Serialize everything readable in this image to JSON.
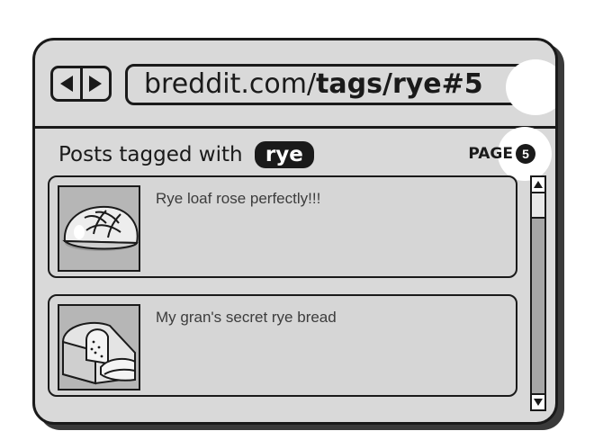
{
  "browser": {
    "back_button": "back",
    "forward_button": "forward",
    "url": {
      "domain": "breddit.com/",
      "path": "tags/rye",
      "anchor": "#5"
    }
  },
  "header": {
    "title_prefix": "Posts tagged with",
    "tag": "rye",
    "page_label": "PAGE",
    "page_number": "5"
  },
  "posts": [
    {
      "title": "Rye loaf rose perfectly!!!",
      "thumbnail": "round-rye-loaf-image"
    },
    {
      "title": "My gran's secret rye bread",
      "thumbnail": "sliced-rye-loaf-image"
    }
  ],
  "colors": {
    "window": "#d9d9d9",
    "outline": "#1a1a1a",
    "highlight": "#ffffff",
    "scrollbar": "#a6a6a6"
  }
}
